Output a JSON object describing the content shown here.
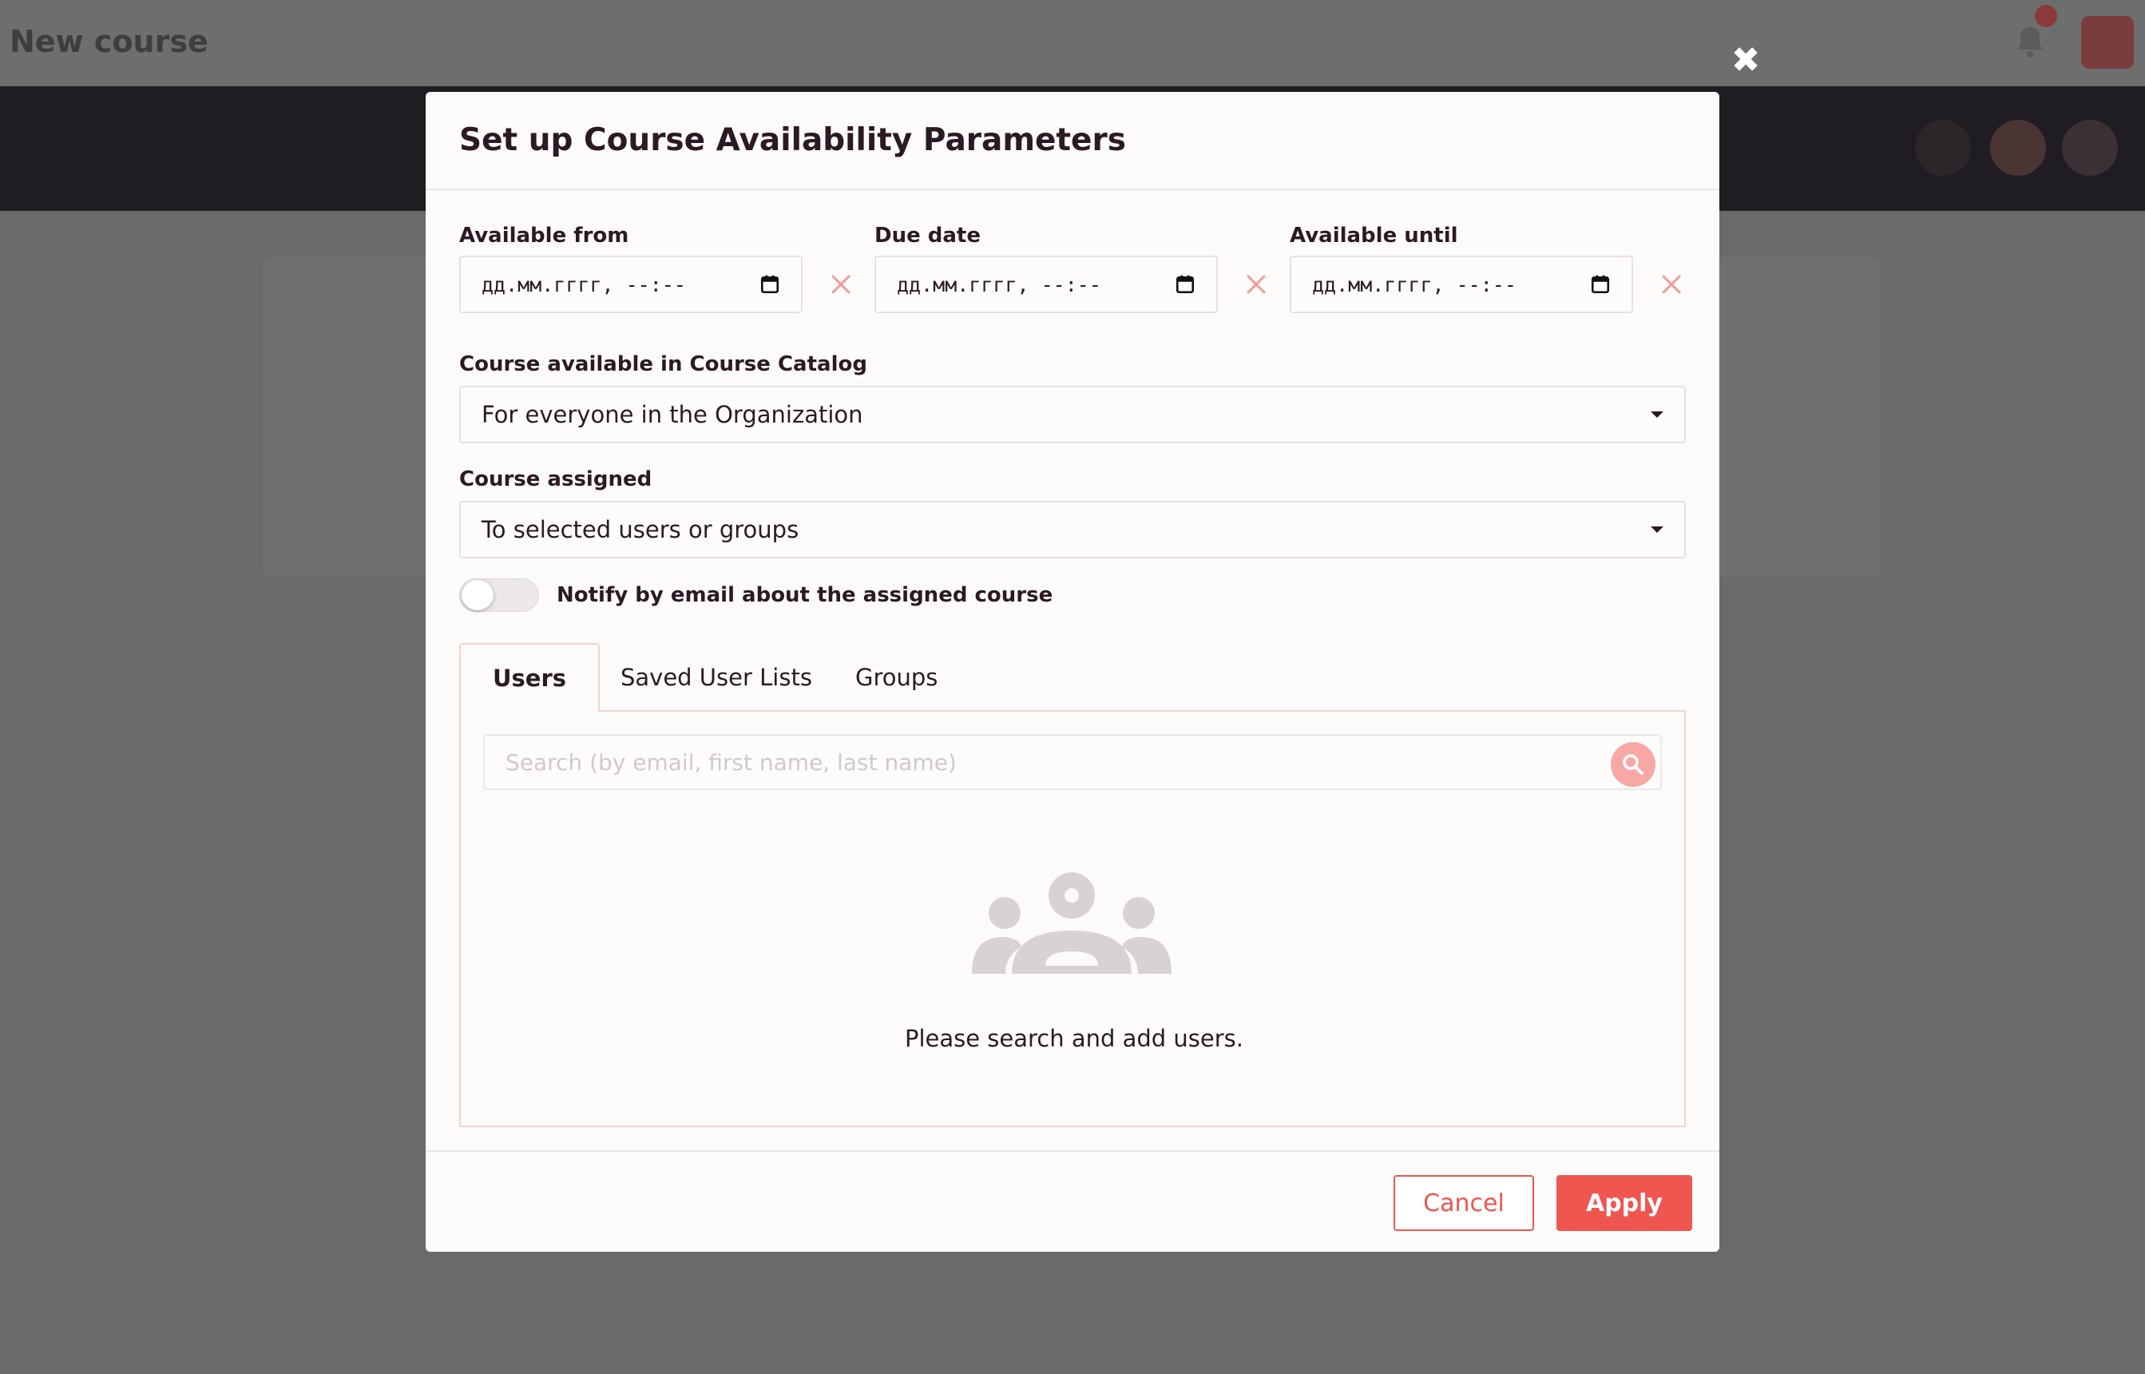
{
  "background": {
    "page_title": "New course"
  },
  "modal": {
    "title": "Set up Course Availability Parameters",
    "dates": [
      {
        "label": "Available from",
        "value": "дд.мм.гггг, --:--"
      },
      {
        "label": "Due date",
        "value": "дд.мм.гггг, --:--"
      },
      {
        "label": "Available until",
        "value": "дд.мм.гггг, --:--"
      }
    ],
    "catalog": {
      "label": "Course available in Course Catalog",
      "value": "For everyone in the Organization"
    },
    "assigned": {
      "label": "Course assigned",
      "value": "To selected users or groups"
    },
    "notify": {
      "label": "Notify by email about the assigned course",
      "enabled": false
    },
    "tabs": [
      {
        "label": "Users",
        "active": true
      },
      {
        "label": "Saved User Lists",
        "active": false
      },
      {
        "label": "Groups",
        "active": false
      }
    ],
    "search": {
      "placeholder": "Search (by email, first name, last name)",
      "value": ""
    },
    "empty_state": {
      "message": "Please search and add users.",
      "icon": "users-group-icon"
    },
    "footer": {
      "cancel_label": "Cancel",
      "apply_label": "Apply"
    }
  },
  "colors": {
    "accent": "#ef5650",
    "accent_light": "#f7a8a4",
    "clear_icon": "#f29a96",
    "text": "#2b1a24",
    "overlay": "#6a6a6a"
  }
}
